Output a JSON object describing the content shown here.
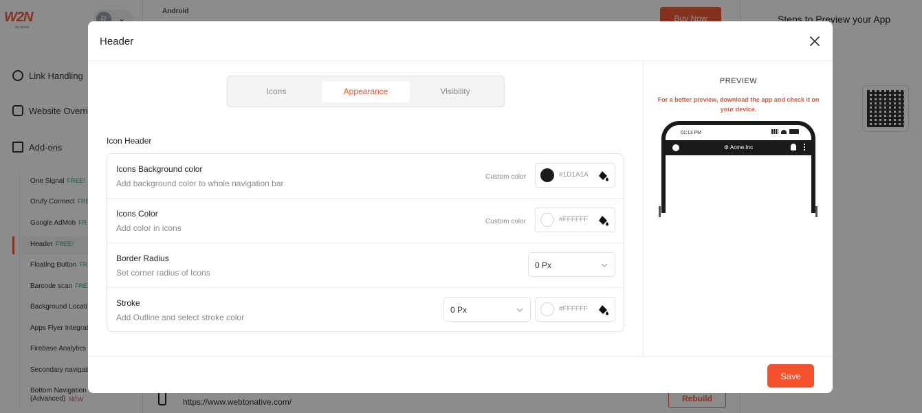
{
  "background": {
    "logo": "W2N",
    "logo_sub": "by tenzo",
    "avatar_initial": "R",
    "nav": [
      "Link Handling",
      "Website Override",
      "Add-ons"
    ],
    "subnav": [
      {
        "label": "One Signal",
        "tag": "FREE!",
        "tag_type": "free"
      },
      {
        "label": "Orufy Connect",
        "tag": "FRE",
        "tag_type": "free"
      },
      {
        "label": "Google AdMob",
        "tag": "FR",
        "tag_type": "free"
      },
      {
        "label": "Header",
        "tag": "FREE!",
        "tag_type": "free"
      },
      {
        "label": "Floating Button",
        "tag": "FR",
        "tag_type": "free"
      },
      {
        "label": "Barcode scan",
        "tag": "FREE",
        "tag_type": "free"
      },
      {
        "label": "Background Locati",
        "tag": "",
        "tag_type": "free"
      },
      {
        "label": "Apps Flyer Integrat",
        "tag": "",
        "tag_type": "free"
      },
      {
        "label": "Firebase Analytics",
        "tag": "",
        "tag_type": "free"
      },
      {
        "label": "Secondary navigati",
        "tag": "",
        "tag_type": "free"
      },
      {
        "label": "Bottom Navigation (Advanced)",
        "tag": "NEW",
        "tag_type": "new"
      }
    ],
    "crumb": "Android",
    "buy_now": "Buy Now",
    "steps_title": "Steps to Preview your App",
    "url": "https://www.webtonative.com/",
    "rebuild": "Rebuild"
  },
  "modal": {
    "title": "Header",
    "tabs": [
      "Icons",
      "Appearance",
      "Visibility"
    ],
    "active_tab": "Appearance",
    "section_title": "Icon Header",
    "rows": {
      "bg_color": {
        "label": "Icons Background color",
        "desc": "Add background color to whole navigation bar",
        "custom": "Custom color",
        "hex": "#1D1A1A"
      },
      "icon_color": {
        "label": "Icons Color",
        "desc": "Add color in icons",
        "custom": "Custom color",
        "hex": "#FFFFFF"
      },
      "border_radius": {
        "label": "Border Radius",
        "desc": "Set corner radius of Icons",
        "value": "0 Px"
      },
      "stroke": {
        "label": "Stroke",
        "desc": "Add Outline and select stroke color",
        "value": "0 Px",
        "hex": "#FFFFFF"
      }
    },
    "save": "Save"
  },
  "preview": {
    "title": "PREVIEW",
    "note": "For a better preview, download the app and check it on your device.",
    "time": "01:13 PM",
    "brand": "Acme.Inc"
  },
  "colors": {
    "accent": "#f4512c",
    "swatch_dark": "#1D1A1A",
    "swatch_light": "#FFFFFF"
  }
}
